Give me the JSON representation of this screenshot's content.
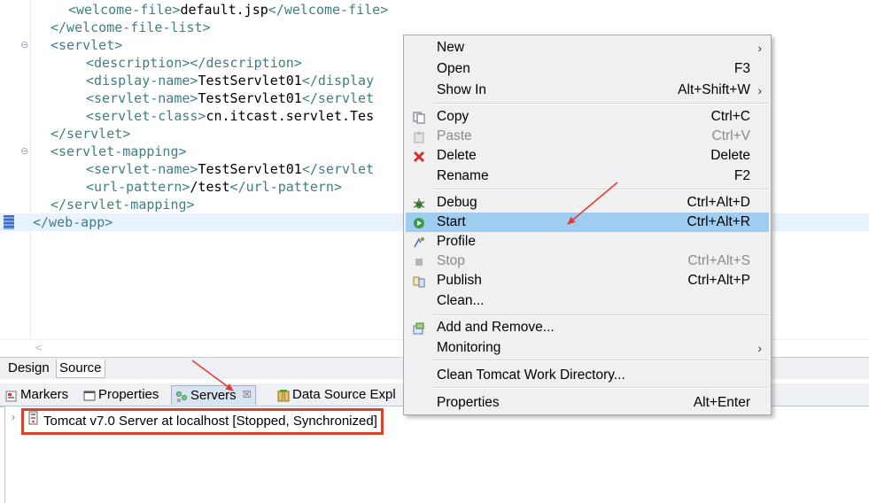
{
  "editor": {
    "lines": [
      {
        "indent": 4,
        "parts": [
          [
            "tag",
            "<welcome-file>"
          ],
          [
            "txt",
            "default.jsp"
          ],
          [
            "tag",
            "</welcome-file>"
          ]
        ],
        "fold": false
      },
      {
        "indent": 2,
        "parts": [
          [
            "tag",
            "</welcome-file-list>"
          ]
        ],
        "fold": false
      },
      {
        "indent": 2,
        "parts": [
          [
            "tag",
            "<servlet>"
          ]
        ],
        "fold": true
      },
      {
        "indent": 6,
        "parts": [
          [
            "tag",
            "<description></description>"
          ]
        ],
        "fold": false
      },
      {
        "indent": 6,
        "parts": [
          [
            "tag",
            "<display-name>"
          ],
          [
            "txt",
            "TestServlet01"
          ],
          [
            "tag",
            "</display"
          ]
        ],
        "fold": false
      },
      {
        "indent": 6,
        "parts": [
          [
            "tag",
            "<servlet-name>"
          ],
          [
            "txt",
            "TestServlet01"
          ],
          [
            "tag",
            "</servlet"
          ]
        ],
        "fold": false
      },
      {
        "indent": 6,
        "parts": [
          [
            "tag",
            "<servlet-class>"
          ],
          [
            "txt",
            "cn.itcast.servlet.Tes"
          ]
        ],
        "fold": false
      },
      {
        "indent": 2,
        "parts": [
          [
            "tag",
            "</servlet>"
          ]
        ],
        "fold": false
      },
      {
        "indent": 2,
        "parts": [
          [
            "tag",
            "<servlet-mapping>"
          ]
        ],
        "fold": true
      },
      {
        "indent": 6,
        "parts": [
          [
            "tag",
            "<servlet-name>"
          ],
          [
            "txt",
            "TestServlet01"
          ],
          [
            "tag",
            "</servlet"
          ]
        ],
        "fold": false
      },
      {
        "indent": 6,
        "parts": [
          [
            "tag",
            "<url-pattern>"
          ],
          [
            "txt",
            "/test"
          ],
          [
            "tag",
            "</url-pattern>"
          ]
        ],
        "fold": false
      },
      {
        "indent": 2,
        "parts": [
          [
            "tag",
            "</servlet-mapping>"
          ]
        ],
        "fold": false
      },
      {
        "indent": 0,
        "parts": [
          [
            "tag",
            "</web-app>"
          ]
        ],
        "fold": false,
        "current": true
      }
    ],
    "scroll_left_glyph": "<",
    "fold_glyph": "⊖"
  },
  "editor_tabs": {
    "design": "Design",
    "source": "Source"
  },
  "view_tabs": {
    "markers": "Markers",
    "properties": "Properties",
    "servers": "Servers",
    "servers_close": "☒",
    "data_source": "Data Source Expl"
  },
  "servers_view": {
    "expand": "›",
    "server_label": "Tomcat v7.0 Server at localhost  [Stopped, Synchronized]"
  },
  "context_menu": {
    "items": [
      {
        "label": "New",
        "accel": "",
        "submenu": true,
        "icon": "",
        "disabled": false
      },
      {
        "label": "Open",
        "accel": "F3",
        "submenu": false,
        "icon": "",
        "disabled": false
      },
      {
        "label": "Show In",
        "accel": "Alt+Shift+W",
        "submenu": true,
        "icon": "",
        "disabled": false
      },
      {
        "label": "Copy",
        "accel": "Ctrl+C",
        "submenu": false,
        "icon": "copy-icon",
        "disabled": false
      },
      {
        "label": "Paste",
        "accel": "Ctrl+V",
        "submenu": false,
        "icon": "paste-icon",
        "disabled": true
      },
      {
        "label": "Delete",
        "accel": "Delete",
        "submenu": false,
        "icon": "delete-icon",
        "disabled": false
      },
      {
        "label": "Rename",
        "accel": "F2",
        "submenu": false,
        "icon": "",
        "disabled": false
      },
      {
        "label": "Debug",
        "accel": "Ctrl+Alt+D",
        "submenu": false,
        "icon": "debug-icon",
        "disabled": false
      },
      {
        "label": "Start",
        "accel": "Ctrl+Alt+R",
        "submenu": false,
        "icon": "start-icon",
        "disabled": false,
        "highlight": true
      },
      {
        "label": "Profile",
        "accel": "",
        "submenu": false,
        "icon": "profile-icon",
        "disabled": false
      },
      {
        "label": "Stop",
        "accel": "Ctrl+Alt+S",
        "submenu": false,
        "icon": "stop-icon",
        "disabled": true
      },
      {
        "label": "Publish",
        "accel": "Ctrl+Alt+P",
        "submenu": false,
        "icon": "publish-icon",
        "disabled": false
      },
      {
        "label": "Clean...",
        "accel": "",
        "submenu": false,
        "icon": "",
        "disabled": false
      },
      {
        "label": "Add and Remove...",
        "accel": "",
        "submenu": false,
        "icon": "add-remove-icon",
        "disabled": false
      },
      {
        "label": "Monitoring",
        "accel": "",
        "submenu": true,
        "icon": "",
        "disabled": false
      },
      {
        "label": "Clean Tomcat Work Directory...",
        "accel": "",
        "submenu": false,
        "icon": "",
        "disabled": false
      },
      {
        "label": "Properties",
        "accel": "Alt+Enter",
        "submenu": false,
        "icon": "",
        "disabled": false
      }
    ],
    "submenu_glyph": "›"
  },
  "colors": {
    "tag": "#3f7f7f",
    "highlight": "#9fcdf1",
    "annotation": "#e53935",
    "server_box": "#d6442b"
  }
}
